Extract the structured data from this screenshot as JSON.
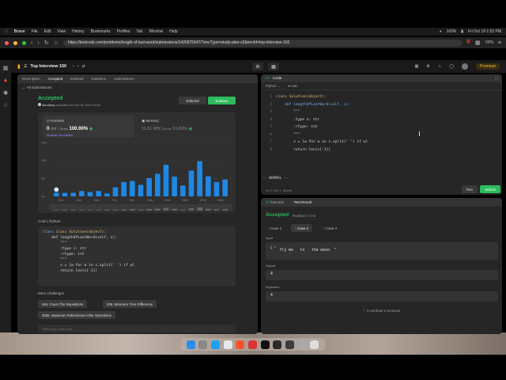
{
  "menubar": {
    "app": "Brave",
    "items": [
      "File",
      "Edit",
      "View",
      "History",
      "Bookmarks",
      "Profiles",
      "Tab",
      "Window",
      "Help"
    ],
    "battery": "100%",
    "clock": "Fri Oct 18 1:52 PM"
  },
  "browser": {
    "url": "https://leetcode.com/problems/length-of-last-word/submissions/1426875647/?envType=study-plan-v2&envId=top-interview-150",
    "vpn": "VPN"
  },
  "header": {
    "title": "Top Interview 150",
    "premium": "Premium"
  },
  "left_tabs": [
    "Description",
    "Accepted",
    "Editorial",
    "Solutions",
    "Submissions"
  ],
  "all_submissions": "All Submissions",
  "submission": {
    "status": "Accepted",
    "user": "dsrollbng",
    "submitted": "submitted at Oct 18, 2024 10:52",
    "editorial_btn": "Editorial",
    "solution_btn": "Solution",
    "runtime_label": "Runtime",
    "runtime_value": "0",
    "runtime_unit": "ms",
    "runtime_beats_label": "Beats",
    "runtime_beats": "100.00%",
    "analyze": "Analyze Complexity",
    "memory_label": "Memory",
    "memory_value": "11.61",
    "memory_unit": "MB",
    "memory_beats_label": "Beats",
    "memory_beats": "91.69%"
  },
  "chart_data": {
    "type": "bar",
    "y_ticks": [
      "15%",
      "10%",
      "5%",
      "0%"
    ],
    "x_ticks": [
      "0ms",
      "3ms",
      "5ms",
      "7ms",
      "9ms",
      "11ms",
      "13ms",
      "15ms",
      "17ms",
      "19ms"
    ],
    "ylim": [
      0,
      15
    ],
    "values": [
      1,
      1,
      1,
      1.5,
      1.2,
      1.5,
      0.8,
      2.5,
      4,
      4.3,
      3.2,
      5.1,
      6.3,
      8.8,
      5.5,
      3,
      7.2,
      9.8,
      5.6,
      4,
      4.7
    ],
    "highlight_index": 0,
    "colors": {
      "bar": "#1e88e5",
      "highlight": "#ffffff"
    }
  },
  "code_section": {
    "label": "Code",
    "lang": "Python",
    "lines": [
      "class Solution(object):",
      "    def lengthOfLastWord(self, s):",
      "        \"\"\"",
      "        :type s: str",
      "        :rtype: int",
      "        \"\"\"",
      "        v = [w for w in s.split(' ') if w]",
      "        return len(v[-1])"
    ]
  },
  "more_challenges": {
    "label": "More challenges",
    "items": [
      "466. Count The Repetitions",
      "539. Minimum Time Difference",
      "3035. Maximum Palindromes After Operations"
    ]
  },
  "notes_placeholder": "Write your notes here",
  "editor": {
    "title": "Code",
    "lang": "Python",
    "auto": "Auto",
    "vim_mode": "-- NORMAL --",
    "status": "Ln 1, Col 1",
    "saved": "Saved",
    "run": "Run",
    "submit": "Submit",
    "lines": [
      "class Solution(object):",
      "    def lengthOfLastWord(self, s):",
      "        \"\"\"",
      "        :type s: str",
      "        :rtype: int",
      "        \"\"\"",
      "        v = [w for w in s.split(' ') if w]",
      "        return len(v[-1])"
    ]
  },
  "result": {
    "tabs": [
      "Testcase",
      "Test Result"
    ],
    "status": "Accepted",
    "runtime": "Runtime: 0 ms",
    "cases": [
      "Case 1",
      "Case 2",
      "Case 3"
    ],
    "input_label": "Input",
    "input_var": "s =",
    "input_value": "\"   fly me   to   the moon  \"",
    "output_label": "Output",
    "output_value": "4",
    "expected_label": "Expected",
    "expected_value": "4",
    "contribute": "Contribute a testcase"
  }
}
